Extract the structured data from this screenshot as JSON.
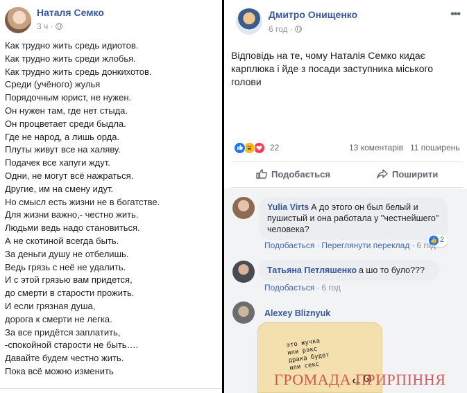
{
  "left_post": {
    "author": "Наталя Семко",
    "time": "3 ч ·",
    "poem_lines": [
      "Как трудно жить средь идиотов.",
      "Как трудно жить среди жлобья.",
      "Как трудно жить средь донкихотов.",
      "Среди (учёного) жулья",
      "Порядочным юрист, не нужен.",
      "Он нужен там, где нет стыда.",
      "Он процветает среди быдла.",
      "Где не народ, а лишь орда.",
      "Плуты живут все на халяву.",
      "Подачек все хапуги ждут.",
      "Одни, не могут всё нажраться.",
      "Другие, им на смену идут.",
      "Но смысл есть жизни не в богатстве.",
      "Для жизни важно,- честно жить.",
      "Людьми ведь надо становиться.",
      "А не скотиной всегда быть.",
      "За деньги душу не отбелишь.",
      "Ведь грязь с неё не удалить.",
      "И с этой грязью вам придется,",
      "до смерти в старости прожить.",
      "И если грязная душа,",
      "дорога к смерти не легка.",
      "За все придётся заплатить,",
      "-спокойной старости не быть….",
      "Давайте будем честно жить.",
      "Пока всё можно изменить"
    ]
  },
  "right_post": {
    "author": "Дмитро Онищенко",
    "time": "6 год ·",
    "more_label": "•••",
    "text": "Відповідь на те, чому Наталія Семко кидає карплюка і йде з посади заступника міського голови",
    "reaction_count": "22",
    "comments_count": "13 коментарів",
    "shares_count": "11 поширень",
    "like_label": "Подобається",
    "share_label": "Поширити",
    "comments": [
      {
        "author": "Yulia Virts",
        "text": "А до этого он был белый и пушистый и она работала у \"честнейшего\" человека?",
        "like_label": "Подобається",
        "see_translation": "Переглянути переклад",
        "time": "6 год",
        "likes": "2"
      },
      {
        "author": "Татьяна Петляшенко",
        "text": "а шо то було???",
        "like_label": "Подобається",
        "time": "6 год"
      },
      {
        "author": "Alexey Bliznyuk",
        "image_text": "это жучка\nили рэкс\nдрака будет\nили секс"
      }
    ]
  },
  "watermark": "ГРОМАДА ПРИРПІННЯ",
  "colors": {
    "link_blue": "#385898",
    "like_blue": "#1877f2",
    "love_red": "#f33e58",
    "haha_yellow": "#f7b928",
    "watermark_red": "#c82828"
  },
  "icons": [
    "globe-icon",
    "more-icon",
    "like-reaction-icon",
    "haha-reaction-icon",
    "love-reaction-icon",
    "thumbs-up-icon",
    "share-arrow-icon"
  ]
}
